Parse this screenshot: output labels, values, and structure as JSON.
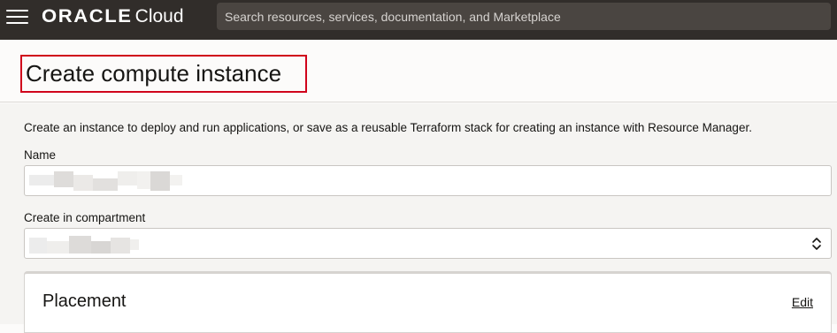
{
  "topbar": {
    "menu_icon": "hamburger-menu-icon",
    "brand_oracle": "ORACLE",
    "brand_cloud": "Cloud",
    "search_placeholder": "Search resources, services, documentation, and Marketplace"
  },
  "header": {
    "title": "Create compute instance"
  },
  "form": {
    "intro": "Create an instance to deploy and run applications, or save as a reusable Terraform stack for creating an instance with Resource Manager.",
    "name_label": "Name",
    "compartment_label": "Create in compartment",
    "compartment_select_icon": "chevron-up-down-icon"
  },
  "placement": {
    "title": "Placement",
    "edit_label": "Edit"
  },
  "colors": {
    "topbar_bg": "#312d2a",
    "highlight_border": "#d0021b",
    "page_bg": "#f5f4f2"
  }
}
